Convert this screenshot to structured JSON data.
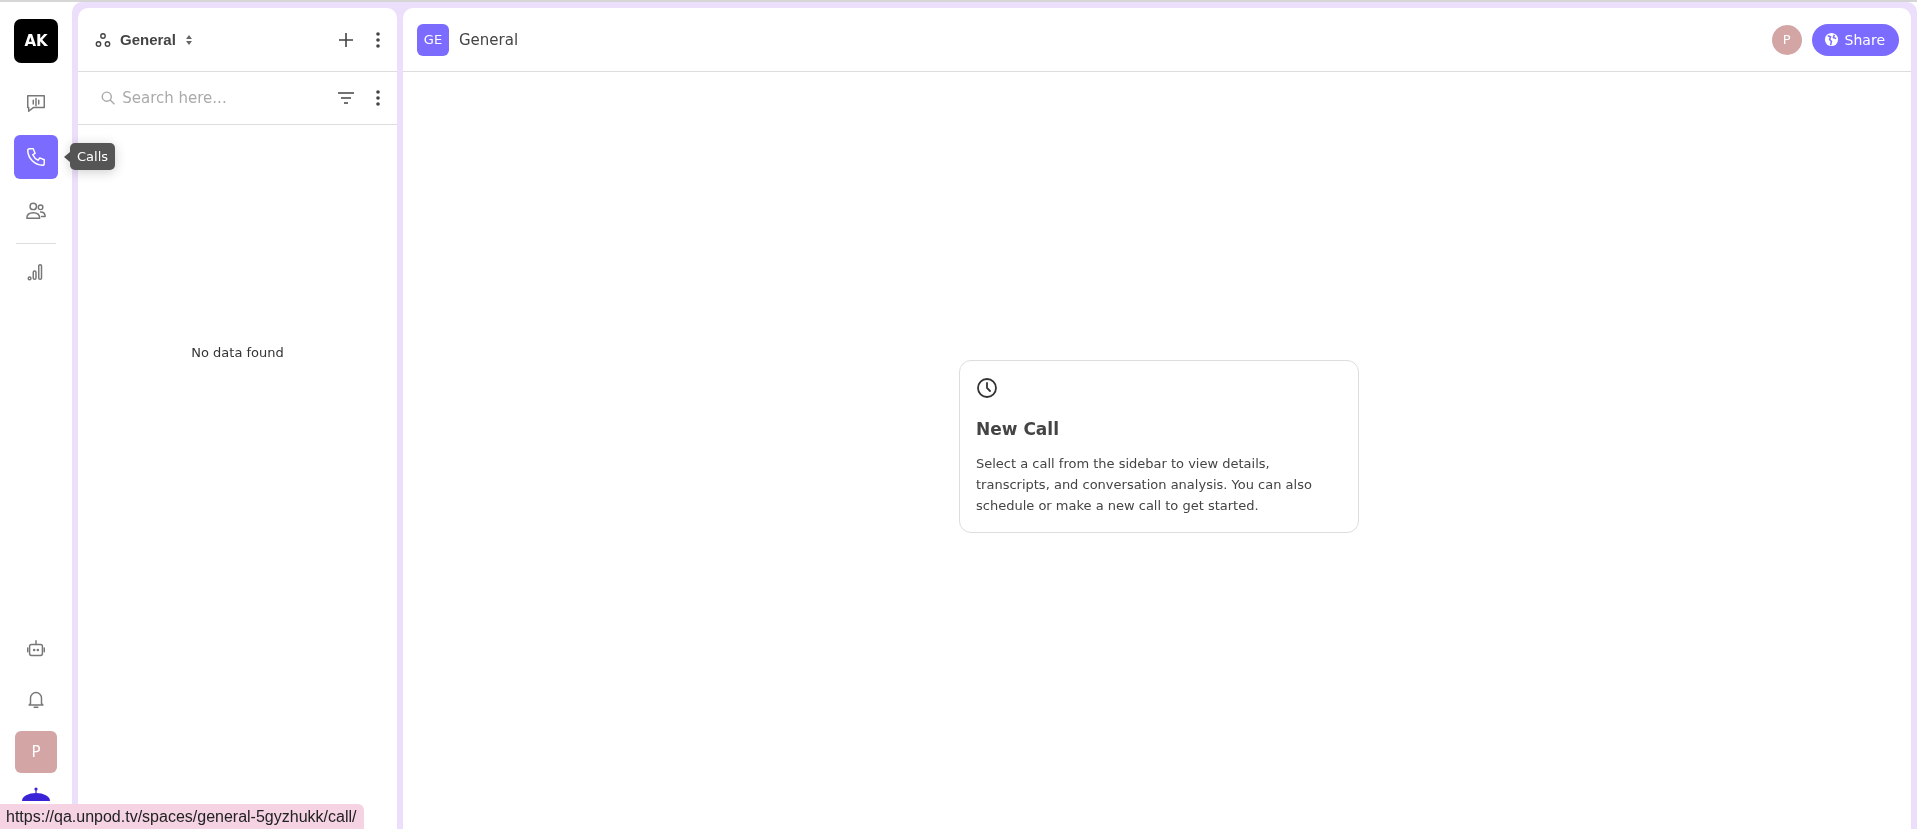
{
  "rail": {
    "logo": "AK",
    "nav_items": [
      {
        "kind": "chat",
        "selected": false
      },
      {
        "kind": "calls",
        "selected": true
      },
      {
        "kind": "people",
        "selected": false
      }
    ],
    "nav_items_secondary": [
      {
        "kind": "analytics",
        "selected": false
      }
    ],
    "tooltip": "Calls",
    "bottom_items": [
      {
        "kind": "robot"
      },
      {
        "kind": "bell"
      }
    ],
    "user_avatar": "P"
  },
  "list_panel": {
    "space_name": "General",
    "search": {
      "placeholder": "Search here..."
    },
    "empty_text": "No data found"
  },
  "main": {
    "badge": "GE",
    "title": "General",
    "avatar": "P",
    "share_button": "Share",
    "card": {
      "title": "New Call",
      "body": "Select a call from the sidebar to view details, transcripts, and conversation analysis. You can also schedule or make a new call to get started."
    }
  },
  "status_url": "https://qa.unpod.tv/spaces/general-5gyzhukk/call/"
}
